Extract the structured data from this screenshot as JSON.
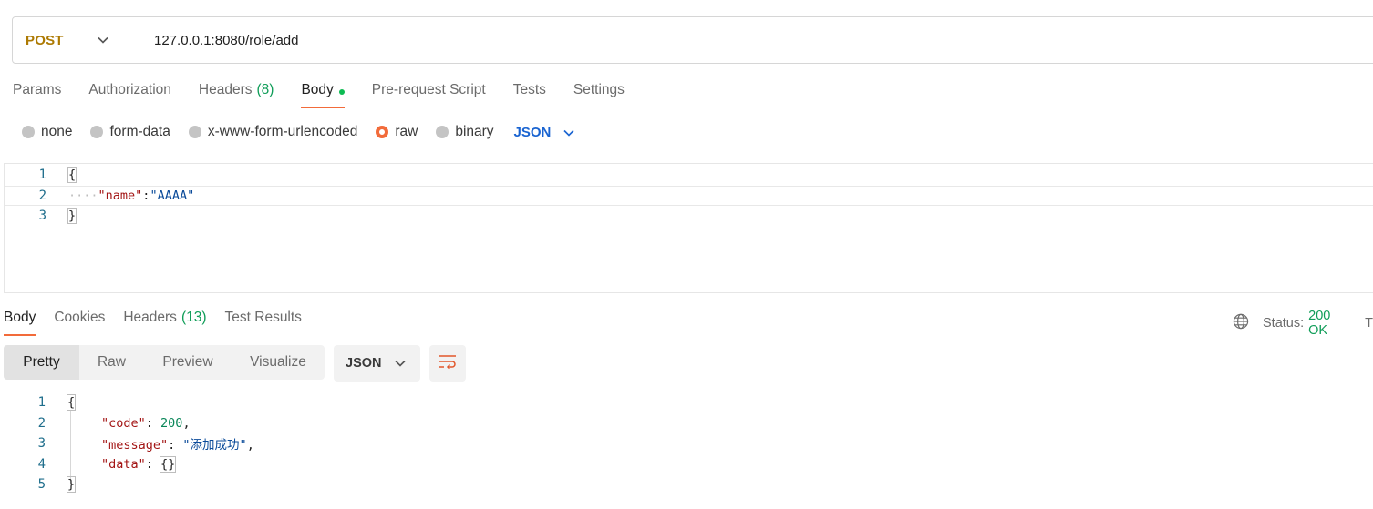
{
  "request": {
    "method": "POST",
    "url": "127.0.0.1:8080/role/add"
  },
  "tabs": [
    {
      "label": "Params"
    },
    {
      "label": "Authorization"
    },
    {
      "label": "Headers",
      "count": "(8)"
    },
    {
      "label": "Body"
    },
    {
      "label": "Pre-request Script"
    },
    {
      "label": "Tests"
    },
    {
      "label": "Settings"
    }
  ],
  "body_types": [
    {
      "label": "none"
    },
    {
      "label": "form-data"
    },
    {
      "label": "x-www-form-urlencoded"
    },
    {
      "label": "raw"
    },
    {
      "label": "binary"
    }
  ],
  "body_format": "JSON",
  "request_body": {
    "line_numbers": [
      "1",
      "2",
      "3"
    ],
    "open": "{",
    "indent": "····",
    "key": "\"name\"",
    "colon": ":",
    "value": "\"AAAA\"",
    "close": "}"
  },
  "response_tabs": [
    {
      "label": "Body"
    },
    {
      "label": "Cookies"
    },
    {
      "label": "Headers",
      "count": "(13)"
    },
    {
      "label": "Test Results"
    }
  ],
  "status": {
    "label": "Status:",
    "value": "200 OK",
    "truncated": "T"
  },
  "views": [
    {
      "label": "Pretty"
    },
    {
      "label": "Raw"
    },
    {
      "label": "Preview"
    },
    {
      "label": "Visualize"
    }
  ],
  "response_format": "JSON",
  "response_body": {
    "line_numbers": [
      "1",
      "2",
      "3",
      "4",
      "5"
    ],
    "open": "{",
    "code_key": "\"code\"",
    "code_value": "200",
    "message_key": "\"message\"",
    "message_value": "\"添加成功\"",
    "data_key": "\"data\"",
    "data_value": "{}",
    "close": "}",
    "colon": ": ",
    "comma": ","
  },
  "colors": {
    "method": "#ad7a03",
    "accent": "#f26b3a",
    "count": "#0f9d58",
    "json_select": "#1a64d1"
  }
}
